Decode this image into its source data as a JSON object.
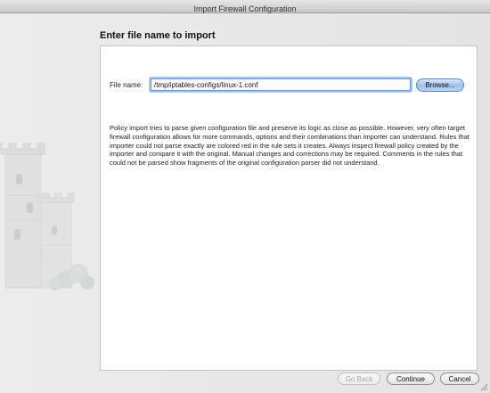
{
  "window": {
    "title": "Import Firewall Configuration"
  },
  "page": {
    "heading": "Enter file name to import"
  },
  "file": {
    "label": "File name:",
    "value": "/tmp/iptables-configs/linux-1.conf",
    "browse_label": "Browse..."
  },
  "description": "Policy import tries to parse given configuration file and preserve its logic as close as possible. However, very often target firewall configuration allows for more commands, options and their combinations than importer can understand. Rules that importer could not parse exactly are colored red in the rule sets it creates. Always inspect firewall policy created by the importer and compare it with the original. Manual changes and corrections may be required. Comments in the rules that could not be parsed show fragments of the original configuration parser did not understand.",
  "footer": {
    "back_label": "Go Back",
    "continue_label": "Continue",
    "cancel_label": "Cancel"
  },
  "colors": {
    "focus_ring": "#a9c7f0",
    "default_button": "#9fc2ee",
    "panel_background": "#ffffff"
  },
  "icons": {
    "watermark": "castle-icon",
    "grip": "resize-grip-icon"
  }
}
